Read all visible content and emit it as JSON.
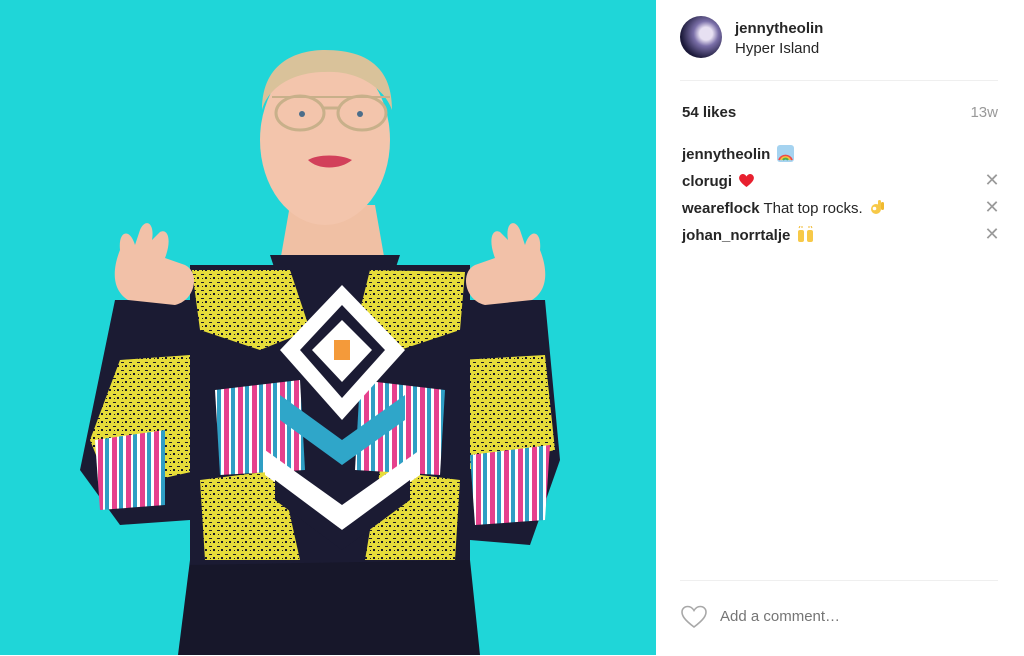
{
  "post": {
    "photo_icon": "person-in-patterned-sweater-photo",
    "author": {
      "username": "jennytheolin",
      "location": "Hyper Island",
      "avatar_icon": "user-avatar"
    },
    "likes": "54 likes",
    "time_ago": "13w",
    "comments": [
      {
        "username": "jennytheolin",
        "text": "",
        "emoji": "rainbow",
        "removable": false
      },
      {
        "username": "clorugi",
        "text": "",
        "emoji": "red-heart",
        "removable": true
      },
      {
        "username": "weareflock",
        "text": "That top rocks.",
        "emoji": "ok-hand",
        "removable": true
      },
      {
        "username": "johan_norrtalje",
        "text": "",
        "emoji": "raising-hands",
        "removable": true
      }
    ],
    "add_comment_placeholder": "Add a comment…"
  },
  "colors": {
    "background": "#1fd6d8",
    "text": "#262626",
    "muted": "#999999",
    "divider": "#efefef"
  }
}
